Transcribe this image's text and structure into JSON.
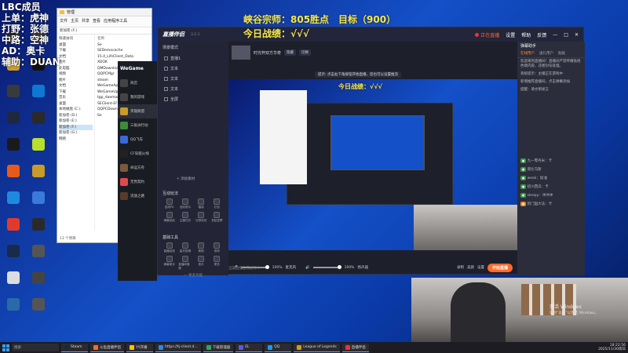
{
  "overlay": {
    "left_lines": [
      "LBC成员",
      "上单：虎神",
      "打野：张德",
      "中路：空神",
      "AD：奥卡",
      "辅助：DUAN"
    ],
    "rank_line": "峡谷宗师：805胜点　目标（900）",
    "today_record": "今日战绩：√√√",
    "preview_record": "今日战绩：√√√"
  },
  "desktop": {
    "col1": [
      "",
      "",
      "",
      "",
      "",
      "",
      "",
      "",
      "",
      "",
      ""
    ],
    "col2": [
      "",
      "",
      "",
      "",
      "",
      "",
      "",
      "",
      "",
      "",
      ""
    ]
  },
  "explorer": {
    "title": "管理",
    "ribbon": [
      "文件",
      "主页",
      "共享",
      "查看",
      "应用程序工具"
    ],
    "address": "新加卷 (F:)",
    "nav": [
      "快速访问",
      "桌面",
      "下载",
      "文档",
      "图片",
      "此电脑",
      "视频",
      "图片",
      "文档",
      "下载",
      "音乐",
      "桌面",
      "本地磁盘 (C:)",
      "新加卷 (D:)",
      "新加卷 (E:)",
      "新加卷 (F:)",
      "新加卷 (G:)",
      "网络"
    ],
    "files": [
      "名称",
      "Se",
      "SEDemocache",
      "15.4_LifsClient_Data",
      "XOOK",
      "QMDownload",
      "QQPCMgr",
      "steam",
      "WeGameApps",
      "WeGameUp",
      "tgp_daemon",
      "SEClient-Ef",
      "QQPCDownload",
      "Se"
    ],
    "status": "13 个项目"
  },
  "app": {
    "name": "直播伴侣",
    "version": "3.2.1",
    "header_status": "正在直播",
    "header_actions": [
      "设置",
      "帮助",
      "反馈"
    ],
    "scene_title": "场景模式",
    "scenes": [
      "直播1",
      "文本",
      "文本",
      "文本",
      "全屏"
    ],
    "add_source": "+ 添加素材",
    "source_title": "时光杯双方华奇",
    "source_buttons": [
      "隐藏",
      "切换"
    ],
    "tip": "提示: 点击右下角按钮开始直播，您也可以设置推流",
    "interact_title": "互动玩法",
    "interact_tools": [
      "连线PK",
      "连线观众",
      "福袋",
      "红包",
      "弹幕贴纸",
      "主播任务",
      "礼物特效",
      "发起投票"
    ],
    "util_title": "基础工具",
    "util_tools": [
      "直播回放",
      "高光剪辑",
      "美颜",
      "音效",
      "弹幕助手",
      "直播间管理",
      "音乐",
      "更多"
    ],
    "more_tools": "— 更多功能",
    "mic_pct": "100%",
    "spk_pct": "100%",
    "ctl_labels": [
      "麦克风",
      "扬声器"
    ],
    "right_ctl": [
      "录制",
      "美颜",
      "设置"
    ],
    "go_live": "开始直播",
    "bottom_note": "当前直播正在进行中",
    "chat_title": "弹幕助手",
    "chat_tabs": [
      "在线用户",
      "送礼用户",
      "贴贴"
    ],
    "chat_messages": [
      "欢迎来到直播间！直播间严禁传播低俗色情内容，违者封号处理。",
      "系统提示：主播正在游戏中",
      "新增推荐直播间，点击弹幕添加",
      "提醒：请文明发言",
      "九一零丹米：卡",
      "莫比乌斯",
      "weak：加油",
      "初川西瓜：卡",
      "sleepy：冲冲冲",
      "新门国大法：卡"
    ]
  },
  "wegame": {
    "logo": "WeGame",
    "items": [
      "商店",
      "我的游戏",
      "英雄联盟",
      "三角洲行动",
      "QQ飞车",
      "CF穿越火线",
      "命运方舟",
      "无畏契约",
      "流放之路"
    ]
  },
  "webcam": {
    "activate_title": "激活 Windows",
    "activate_sub": "转到“设置”以激活 Windows。"
  },
  "taskbar": {
    "search": "搜索",
    "apps": [
      "Steam",
      "斗鱼直播伴侣",
      "YY开播",
      "https://tj-client.d...",
      "下载管理器",
      "EL",
      "QQ",
      "League of Legends",
      "直播伴侣"
    ],
    "time": "18:22:56",
    "date": "2025/11/30周日"
  },
  "colors": {
    "accent": "#ff6a2b",
    "overlay_yellow": "#f5e850",
    "desktop_blue": "#1450c8"
  }
}
